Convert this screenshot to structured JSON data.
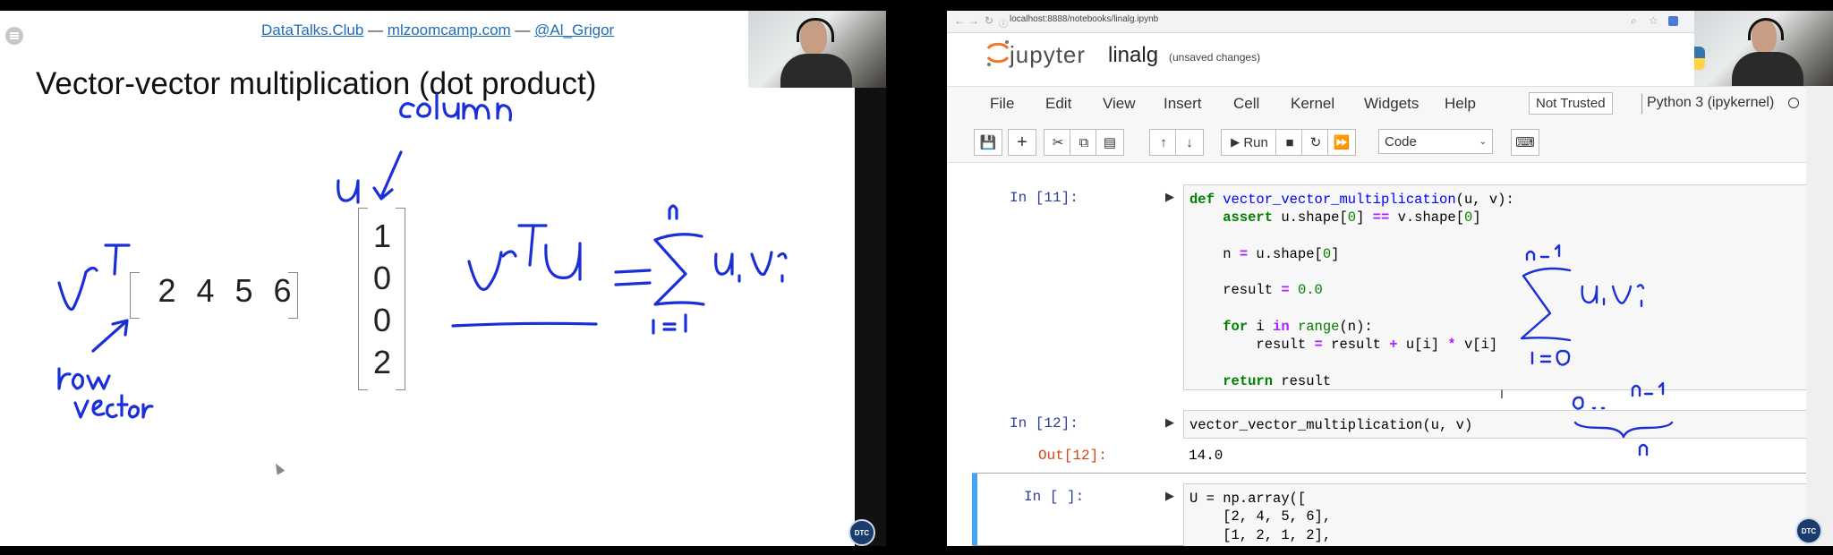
{
  "slide": {
    "header": {
      "site1": "DataTalks.Club",
      "sep1": " — ",
      "site2": "mlzoomcamp.com",
      "sep2": " — ",
      "handle": "@Al_Grigor"
    },
    "title": "Vector-vector multiplication (dot product)",
    "row_vector": [
      "2",
      "4",
      "5",
      "6"
    ],
    "column_vector": [
      "1",
      "0",
      "0",
      "2"
    ],
    "badge": "DTC"
  },
  "browser": {
    "url": "localhost:8888/notebooks/linalg.ipynb",
    "logo_text": "jupyter",
    "notebook_name": "linalg",
    "unsaved": "(unsaved changes)",
    "menu": [
      "File",
      "Edit",
      "View",
      "Insert",
      "Cell",
      "Kernel",
      "Widgets",
      "Help"
    ],
    "not_trusted": "Not Trusted",
    "kernel": "Python 3 (ipykernel)",
    "toolbar": {
      "run_label": "Run",
      "cell_type": "Code"
    },
    "cells": [
      {
        "prompt": "In [11]:",
        "lines": [
          "def vector_vector_multiplication(u, v):",
          "    assert u.shape[0] == v.shape[0]",
          "",
          "    n = u.shape[0]",
          "",
          "    result = 0.0",
          "",
          "    for i in range(n):",
          "        result = result + u[i] * v[i]",
          "",
          "    return result"
        ]
      },
      {
        "prompt": "In [12]:",
        "lines": [
          "vector_vector_multiplication(u, v)"
        ],
        "out_prompt": "Out[12]:",
        "output": "14.0"
      },
      {
        "prompt": "In [ ]:",
        "lines": [
          "U = np.array([",
          "    [2, 4, 5, 6],",
          "    [1, 2, 1, 2],"
        ]
      }
    ],
    "badge": "DTC"
  },
  "colors": {
    "link": "#1f6db5",
    "ink": "#1b2fd6",
    "prompt_in": "#303f9f",
    "prompt_out": "#d84315",
    "selected_cell": "#42a5f5"
  }
}
